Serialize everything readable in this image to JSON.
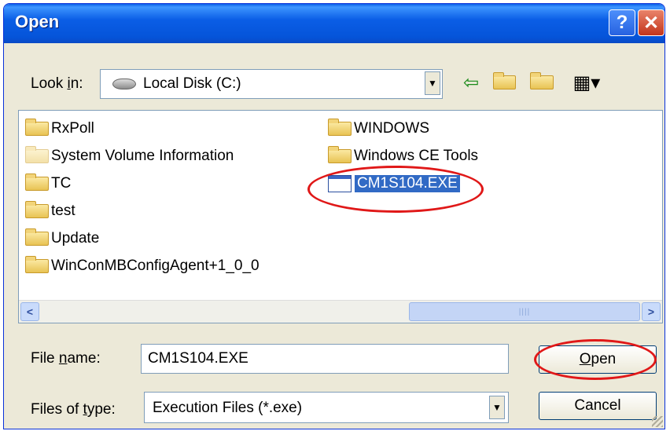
{
  "window": {
    "title": "Open"
  },
  "titlebar": {
    "help_label": "?",
    "close_label": "✕"
  },
  "lookin": {
    "label_pre": "Look ",
    "label_key": "i",
    "label_post": "n:",
    "value": "Local Disk (C:)"
  },
  "toolbar": {
    "back": "⇦",
    "up": "📁",
    "new_folder": "📁",
    "views": "▦▾"
  },
  "files": [
    {
      "name": "RxPoll",
      "kind": "folder"
    },
    {
      "name": "System Volume Information",
      "kind": "hidden-folder"
    },
    {
      "name": "TC",
      "kind": "folder"
    },
    {
      "name": "test",
      "kind": "folder"
    },
    {
      "name": "Update",
      "kind": "folder"
    },
    {
      "name": "WinConMBConfigAgent+1_0_0",
      "kind": "folder"
    },
    {
      "name": "WINDOWS",
      "kind": "folder"
    },
    {
      "name": "Windows CE Tools",
      "kind": "folder"
    },
    {
      "name": "CM1S104.EXE",
      "kind": "exe",
      "selected": true
    }
  ],
  "scrollbar": {
    "left_arrow": "<",
    "right_arrow": ">",
    "thumb_grip": "||||"
  },
  "filename": {
    "label_pre": "File ",
    "label_key": "n",
    "label_post": "ame:",
    "value": "CM1S104.EXE"
  },
  "filetype": {
    "label_pre": "Files of ",
    "label_key": "t",
    "label_post": "ype:",
    "value": "Execution Files (*.exe)"
  },
  "buttons": {
    "open_key": "O",
    "open_rest": "pen",
    "cancel": "Cancel"
  },
  "combo_arrow": "▼",
  "colors": {
    "titlebar": "#0554d9",
    "selection": "#316ac5",
    "annotation": "#e01818",
    "dialog_bg": "#ece9d8"
  }
}
